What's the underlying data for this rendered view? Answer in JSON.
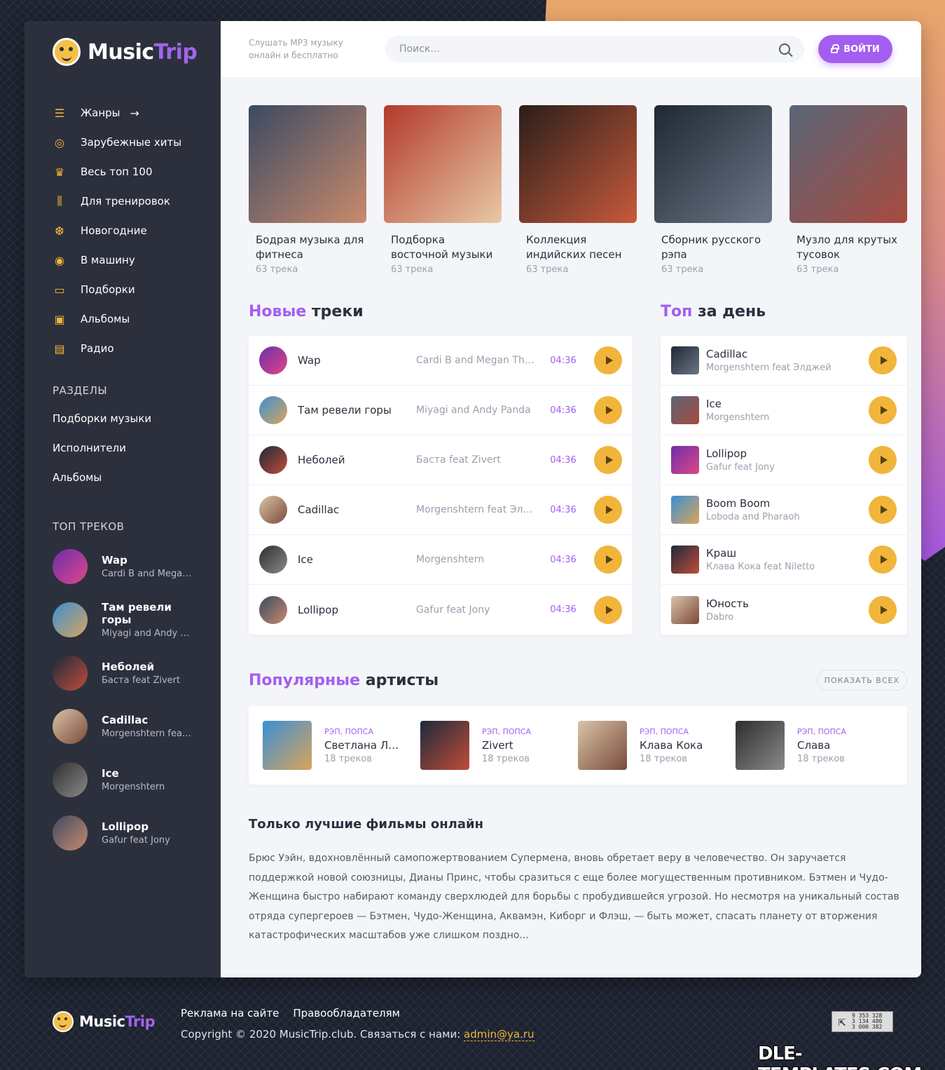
{
  "brand": {
    "name_a": "Music",
    "name_b": "Trip"
  },
  "sidebar": {
    "nav": [
      {
        "label": "Жанры",
        "icon": "equalizer-icon",
        "glyph": "☰"
      },
      {
        "label": "Зарубежные хиты",
        "icon": "vinyl-icon",
        "glyph": "◎"
      },
      {
        "label": "Весь топ 100",
        "icon": "trophy-icon",
        "glyph": "♛"
      },
      {
        "label": "Для тренировок",
        "icon": "dumbbell-icon",
        "glyph": "⫼"
      },
      {
        "label": "Новогодние",
        "icon": "ornament-icon",
        "glyph": "❆"
      },
      {
        "label": "В машину",
        "icon": "wheel-icon",
        "glyph": "◉"
      },
      {
        "label": "Подборки",
        "icon": "folder-icon",
        "glyph": "▭"
      },
      {
        "label": "Альбомы",
        "icon": "album-icon",
        "glyph": "▣"
      },
      {
        "label": "Радио",
        "icon": "radio-icon",
        "glyph": "▤"
      }
    ],
    "sections_title": "РАЗДЕЛЫ",
    "sections": [
      "Подборки музыки",
      "Исполнители",
      "Альбомы"
    ],
    "top_title": "ТОП ТРЕКОВ",
    "top_tracks": [
      {
        "title": "Wap",
        "artist": "Cardi B and Megan Thee Stallion"
      },
      {
        "title": "Там ревели горы",
        "artist": "Miyagi and Andy Panda"
      },
      {
        "title": "Неболей",
        "artist": "Баста feat Zivert"
      },
      {
        "title": "Cadillac",
        "artist": "Morgenshtern feat Элджей"
      },
      {
        "title": "Ice",
        "artist": "Morgenshtern"
      },
      {
        "title": "Lollipop",
        "artist": "Gafur feat Jony"
      }
    ]
  },
  "header": {
    "tagline": "Слушать MP3 музыку онлайн и бесплатно",
    "search_placeholder": "Поиск...",
    "login_label": "ВОЙТИ"
  },
  "collections": [
    {
      "title": "Бодрая музыка для фитнеса",
      "count": "63 трека"
    },
    {
      "title": "Подборка восточной музыки",
      "count": "63 трека"
    },
    {
      "title": "Коллекция индийских песен",
      "count": "63 трека"
    },
    {
      "title": "Сборник русского рэпа",
      "count": "63 трека"
    },
    {
      "title": "Музло для крутых тусовок",
      "count": "63 трека"
    }
  ],
  "new_tracks": {
    "title_accent": "Новые",
    "title_rest": " треки",
    "items": [
      {
        "title": "Wap",
        "artist": "Cardi B and Megan Thee Stallion",
        "time": "04:36"
      },
      {
        "title": "Там ревели горы",
        "artist": "Miyagi and Andy Panda",
        "time": "04:36"
      },
      {
        "title": "Неболей",
        "artist": "Баста feat Zivert",
        "time": "04:36"
      },
      {
        "title": "Cadillac",
        "artist": "Morgenshtern feat Элджей",
        "time": "04:36"
      },
      {
        "title": "Ice",
        "artist": "Morgenshtern",
        "time": "04:36"
      },
      {
        "title": "Lollipop",
        "artist": "Gafur feat Jony",
        "time": "04:36"
      }
    ]
  },
  "top_day": {
    "title_accent": "Топ",
    "title_rest": " за день",
    "items": [
      {
        "title": "Cadillac",
        "artist": "Morgenshtern feat Элджей"
      },
      {
        "title": "Ice",
        "artist": "Morgenshtern"
      },
      {
        "title": "Lollipop",
        "artist": "Gafur feat Jony"
      },
      {
        "title": "Boom Boom",
        "artist": "Loboda and Pharaoh"
      },
      {
        "title": "Краш",
        "artist": "Клава Кока feat Niletto"
      },
      {
        "title": "Юность",
        "artist": "Dabro"
      }
    ]
  },
  "popular": {
    "title_accent": "Популярные",
    "title_rest": " артисты",
    "show_all": "ПОКАЗАТЬ ВСЕХ",
    "items": [
      {
        "genre": "РЭП, ПОПСА",
        "name": "Светлана Лобода",
        "count": "18 треков"
      },
      {
        "genre": "РЭП, ПОПСА",
        "name": "Zivert",
        "count": "18 треков"
      },
      {
        "genre": "РЭП, ПОПСА",
        "name": "Клава Кока",
        "count": "18 треков"
      },
      {
        "genre": "РЭП, ПОПСА",
        "name": "Слава",
        "count": "18 треков"
      }
    ]
  },
  "about": {
    "title": "Только лучшие фильмы онлайн",
    "text": "Брюс Уэйн, вдохновлённый самопожертвованием Супермена, вновь обретает веру в человечество. Он заручается поддержкой новой союзницы, Дианы Принс, чтобы сразиться с еще более могущественным противником. Бэтмен и Чудо-Женщина быстро набирают команду сверхлюдей для борьбы с пробудившейся угрозой. Но несмотря на уникальный состав отряда супергероев — Бэтмен, Чудо-Женщина, Аквамэн, Киборг и Флэш, — быть может, спасать планету от вторжения катастрофических масштабов уже слишком поздно..."
  },
  "footer": {
    "links": [
      "Реклама на сайте",
      "Правообладателям"
    ],
    "copyright": "Copyright © 2020 MusicTrip.club. Связаться с нами: ",
    "email": "admin@ya.ru",
    "counter_lines": [
      "9 353 328",
      "3 134 480",
      "3 000 382"
    ]
  },
  "watermark": "DLE-TEMPLATES.COM",
  "colors": {
    "accent": "#a35ef0",
    "play": "#f0b53a",
    "sidebar": "#2c303d"
  }
}
